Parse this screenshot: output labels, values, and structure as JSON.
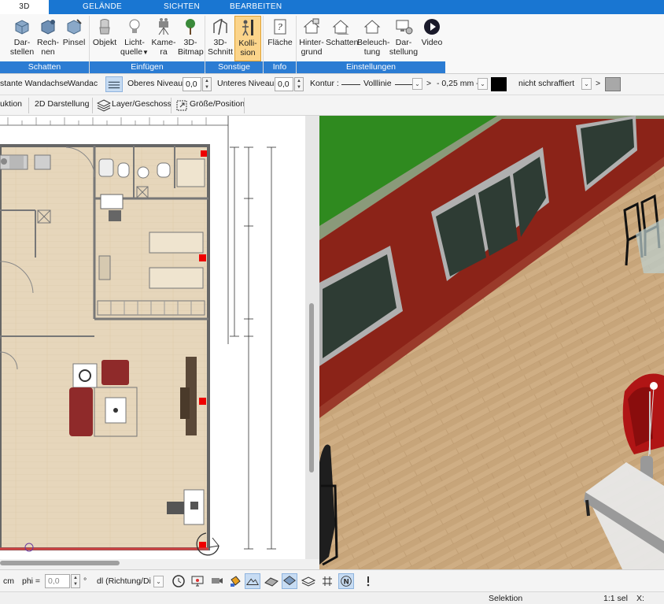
{
  "tabs": [
    {
      "label": "3D",
      "active": true
    },
    {
      "label": "GELÄNDE",
      "active": false
    },
    {
      "label": "SICHTEN",
      "active": false
    },
    {
      "label": "BEARBEITEN",
      "active": false
    }
  ],
  "ribbon": {
    "groups": {
      "schatten": "Schatten",
      "einfuegen": "Einfügen",
      "sonstige": "Sonstige",
      "info": "Info",
      "einstellungen": "Einstellungen"
    },
    "buttons": {
      "darstellen_1": "Dar-",
      "darstellen_2": "stellen",
      "rechnen_1": "Rech-",
      "rechnen_2": "nen",
      "pinsel": "Pinsel",
      "objekt": "Objekt",
      "lichtquelle_1": "Licht-",
      "lichtquelle_2": "quelle",
      "kamera_1": "Kame-",
      "kamera_2": "ra",
      "bitmap_1": "3D-",
      "bitmap_2": "Bitmap",
      "schnitt_1": "3D-",
      "schnitt_2": "Schnitt",
      "kollision_1": "Kolli-",
      "kollision_2": "sion",
      "flaeche": "Fläche",
      "hintergrund_1": "Hinter-",
      "hintergrund_2": "grund",
      "schatten": "Schatten",
      "beleuchtung_1": "Beleuch-",
      "beleuchtung_2": "tung",
      "darstellung_1": "Dar-",
      "darstellung_2": "stellung",
      "video": "Video"
    }
  },
  "propbar": {
    "wandachse_label": "stante Wandachse",
    "wandachse_value": "Wandac",
    "oberes_label": "Oberes Niveau",
    "oberes_value": "0,0",
    "unteres_label": "Unteres Niveau",
    "unteres_value": "0,0",
    "kontur_label": "Kontur :",
    "linie_value": "Volllinie",
    "arrow_gt": ">",
    "stroke_value": "- 0,25 mm -",
    "fill_value": "nicht schraffiert"
  },
  "toolbar2": {
    "konstruktion": "uktion",
    "darstellung2d": "2D Darstellung",
    "layer": "Layer/Geschoss",
    "groesse": "Größe/Position"
  },
  "bottombar": {
    "unit": "cm",
    "phi_label": "phi =",
    "phi_value": "0,0",
    "direction_value": "dl (Richtung/Di"
  },
  "statusbar": {
    "mode": "Selektion",
    "scale": "1:1 sel",
    "x_label": "X:"
  },
  "colors": {
    "ribbon_blue": "#1976d2",
    "group_blue": "#2b7cd3",
    "selected_button": "#fbd48a",
    "wall_red": "#8b2318",
    "grass_green": "#2f8a1f",
    "floor_wood": "#c9a67a"
  },
  "icons": [
    "darstellen-icon",
    "rechnen-icon",
    "pinsel-icon",
    "objekt-icon",
    "lichtquelle-icon",
    "kamera-icon",
    "bitmap-icon",
    "schnitt-icon",
    "kollision-icon",
    "flaeche-icon",
    "hintergrund-icon",
    "schatten-icon",
    "beleuchtung-icon",
    "darstellung-icon",
    "video-icon"
  ]
}
